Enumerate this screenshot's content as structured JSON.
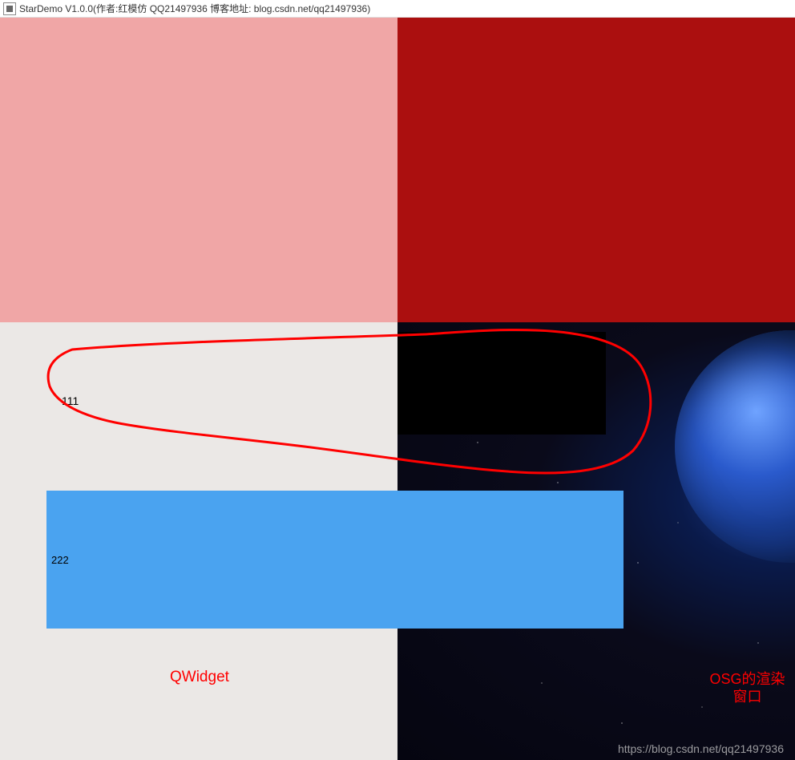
{
  "window": {
    "title": "StarDemo V1.0.0(作者:红模仿 QQ21497936 博客地址: blog.csdn.net/qq21497936)"
  },
  "panels": {
    "top_left_color": "#f0a6a6",
    "top_right_color": "#ab0f0f",
    "bottom_left_color": "#ebe8e6"
  },
  "widgets": {
    "label1": "111",
    "label2": "222"
  },
  "annotations": {
    "qwidget_label": "QWidget",
    "osg_label": "OSG的渲染窗口"
  },
  "watermark": "https://blog.csdn.net/qq21497936"
}
